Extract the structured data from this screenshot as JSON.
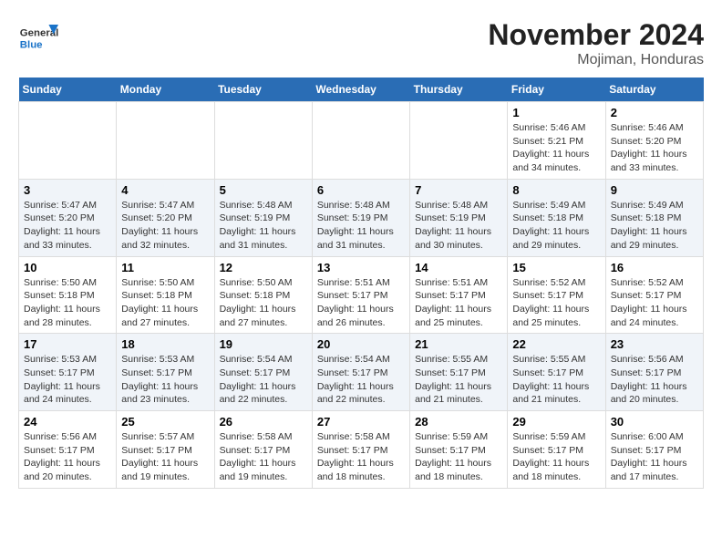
{
  "header": {
    "logo_line1": "General",
    "logo_line2": "Blue",
    "title": "November 2024",
    "subtitle": "Mojiman, Honduras"
  },
  "days_of_week": [
    "Sunday",
    "Monday",
    "Tuesday",
    "Wednesday",
    "Thursday",
    "Friday",
    "Saturday"
  ],
  "weeks": [
    [
      {
        "day": "",
        "info": ""
      },
      {
        "day": "",
        "info": ""
      },
      {
        "day": "",
        "info": ""
      },
      {
        "day": "",
        "info": ""
      },
      {
        "day": "",
        "info": ""
      },
      {
        "day": "1",
        "info": "Sunrise: 5:46 AM\nSunset: 5:21 PM\nDaylight: 11 hours and 34 minutes."
      },
      {
        "day": "2",
        "info": "Sunrise: 5:46 AM\nSunset: 5:20 PM\nDaylight: 11 hours and 33 minutes."
      }
    ],
    [
      {
        "day": "3",
        "info": "Sunrise: 5:47 AM\nSunset: 5:20 PM\nDaylight: 11 hours and 33 minutes."
      },
      {
        "day": "4",
        "info": "Sunrise: 5:47 AM\nSunset: 5:20 PM\nDaylight: 11 hours and 32 minutes."
      },
      {
        "day": "5",
        "info": "Sunrise: 5:48 AM\nSunset: 5:19 PM\nDaylight: 11 hours and 31 minutes."
      },
      {
        "day": "6",
        "info": "Sunrise: 5:48 AM\nSunset: 5:19 PM\nDaylight: 11 hours and 31 minutes."
      },
      {
        "day": "7",
        "info": "Sunrise: 5:48 AM\nSunset: 5:19 PM\nDaylight: 11 hours and 30 minutes."
      },
      {
        "day": "8",
        "info": "Sunrise: 5:49 AM\nSunset: 5:18 PM\nDaylight: 11 hours and 29 minutes."
      },
      {
        "day": "9",
        "info": "Sunrise: 5:49 AM\nSunset: 5:18 PM\nDaylight: 11 hours and 29 minutes."
      }
    ],
    [
      {
        "day": "10",
        "info": "Sunrise: 5:50 AM\nSunset: 5:18 PM\nDaylight: 11 hours and 28 minutes."
      },
      {
        "day": "11",
        "info": "Sunrise: 5:50 AM\nSunset: 5:18 PM\nDaylight: 11 hours and 27 minutes."
      },
      {
        "day": "12",
        "info": "Sunrise: 5:50 AM\nSunset: 5:18 PM\nDaylight: 11 hours and 27 minutes."
      },
      {
        "day": "13",
        "info": "Sunrise: 5:51 AM\nSunset: 5:17 PM\nDaylight: 11 hours and 26 minutes."
      },
      {
        "day": "14",
        "info": "Sunrise: 5:51 AM\nSunset: 5:17 PM\nDaylight: 11 hours and 25 minutes."
      },
      {
        "day": "15",
        "info": "Sunrise: 5:52 AM\nSunset: 5:17 PM\nDaylight: 11 hours and 25 minutes."
      },
      {
        "day": "16",
        "info": "Sunrise: 5:52 AM\nSunset: 5:17 PM\nDaylight: 11 hours and 24 minutes."
      }
    ],
    [
      {
        "day": "17",
        "info": "Sunrise: 5:53 AM\nSunset: 5:17 PM\nDaylight: 11 hours and 24 minutes."
      },
      {
        "day": "18",
        "info": "Sunrise: 5:53 AM\nSunset: 5:17 PM\nDaylight: 11 hours and 23 minutes."
      },
      {
        "day": "19",
        "info": "Sunrise: 5:54 AM\nSunset: 5:17 PM\nDaylight: 11 hours and 22 minutes."
      },
      {
        "day": "20",
        "info": "Sunrise: 5:54 AM\nSunset: 5:17 PM\nDaylight: 11 hours and 22 minutes."
      },
      {
        "day": "21",
        "info": "Sunrise: 5:55 AM\nSunset: 5:17 PM\nDaylight: 11 hours and 21 minutes."
      },
      {
        "day": "22",
        "info": "Sunrise: 5:55 AM\nSunset: 5:17 PM\nDaylight: 11 hours and 21 minutes."
      },
      {
        "day": "23",
        "info": "Sunrise: 5:56 AM\nSunset: 5:17 PM\nDaylight: 11 hours and 20 minutes."
      }
    ],
    [
      {
        "day": "24",
        "info": "Sunrise: 5:56 AM\nSunset: 5:17 PM\nDaylight: 11 hours and 20 minutes."
      },
      {
        "day": "25",
        "info": "Sunrise: 5:57 AM\nSunset: 5:17 PM\nDaylight: 11 hours and 19 minutes."
      },
      {
        "day": "26",
        "info": "Sunrise: 5:58 AM\nSunset: 5:17 PM\nDaylight: 11 hours and 19 minutes."
      },
      {
        "day": "27",
        "info": "Sunrise: 5:58 AM\nSunset: 5:17 PM\nDaylight: 11 hours and 18 minutes."
      },
      {
        "day": "28",
        "info": "Sunrise: 5:59 AM\nSunset: 5:17 PM\nDaylight: 11 hours and 18 minutes."
      },
      {
        "day": "29",
        "info": "Sunrise: 5:59 AM\nSunset: 5:17 PM\nDaylight: 11 hours and 18 minutes."
      },
      {
        "day": "30",
        "info": "Sunrise: 6:00 AM\nSunset: 5:17 PM\nDaylight: 11 hours and 17 minutes."
      }
    ]
  ]
}
